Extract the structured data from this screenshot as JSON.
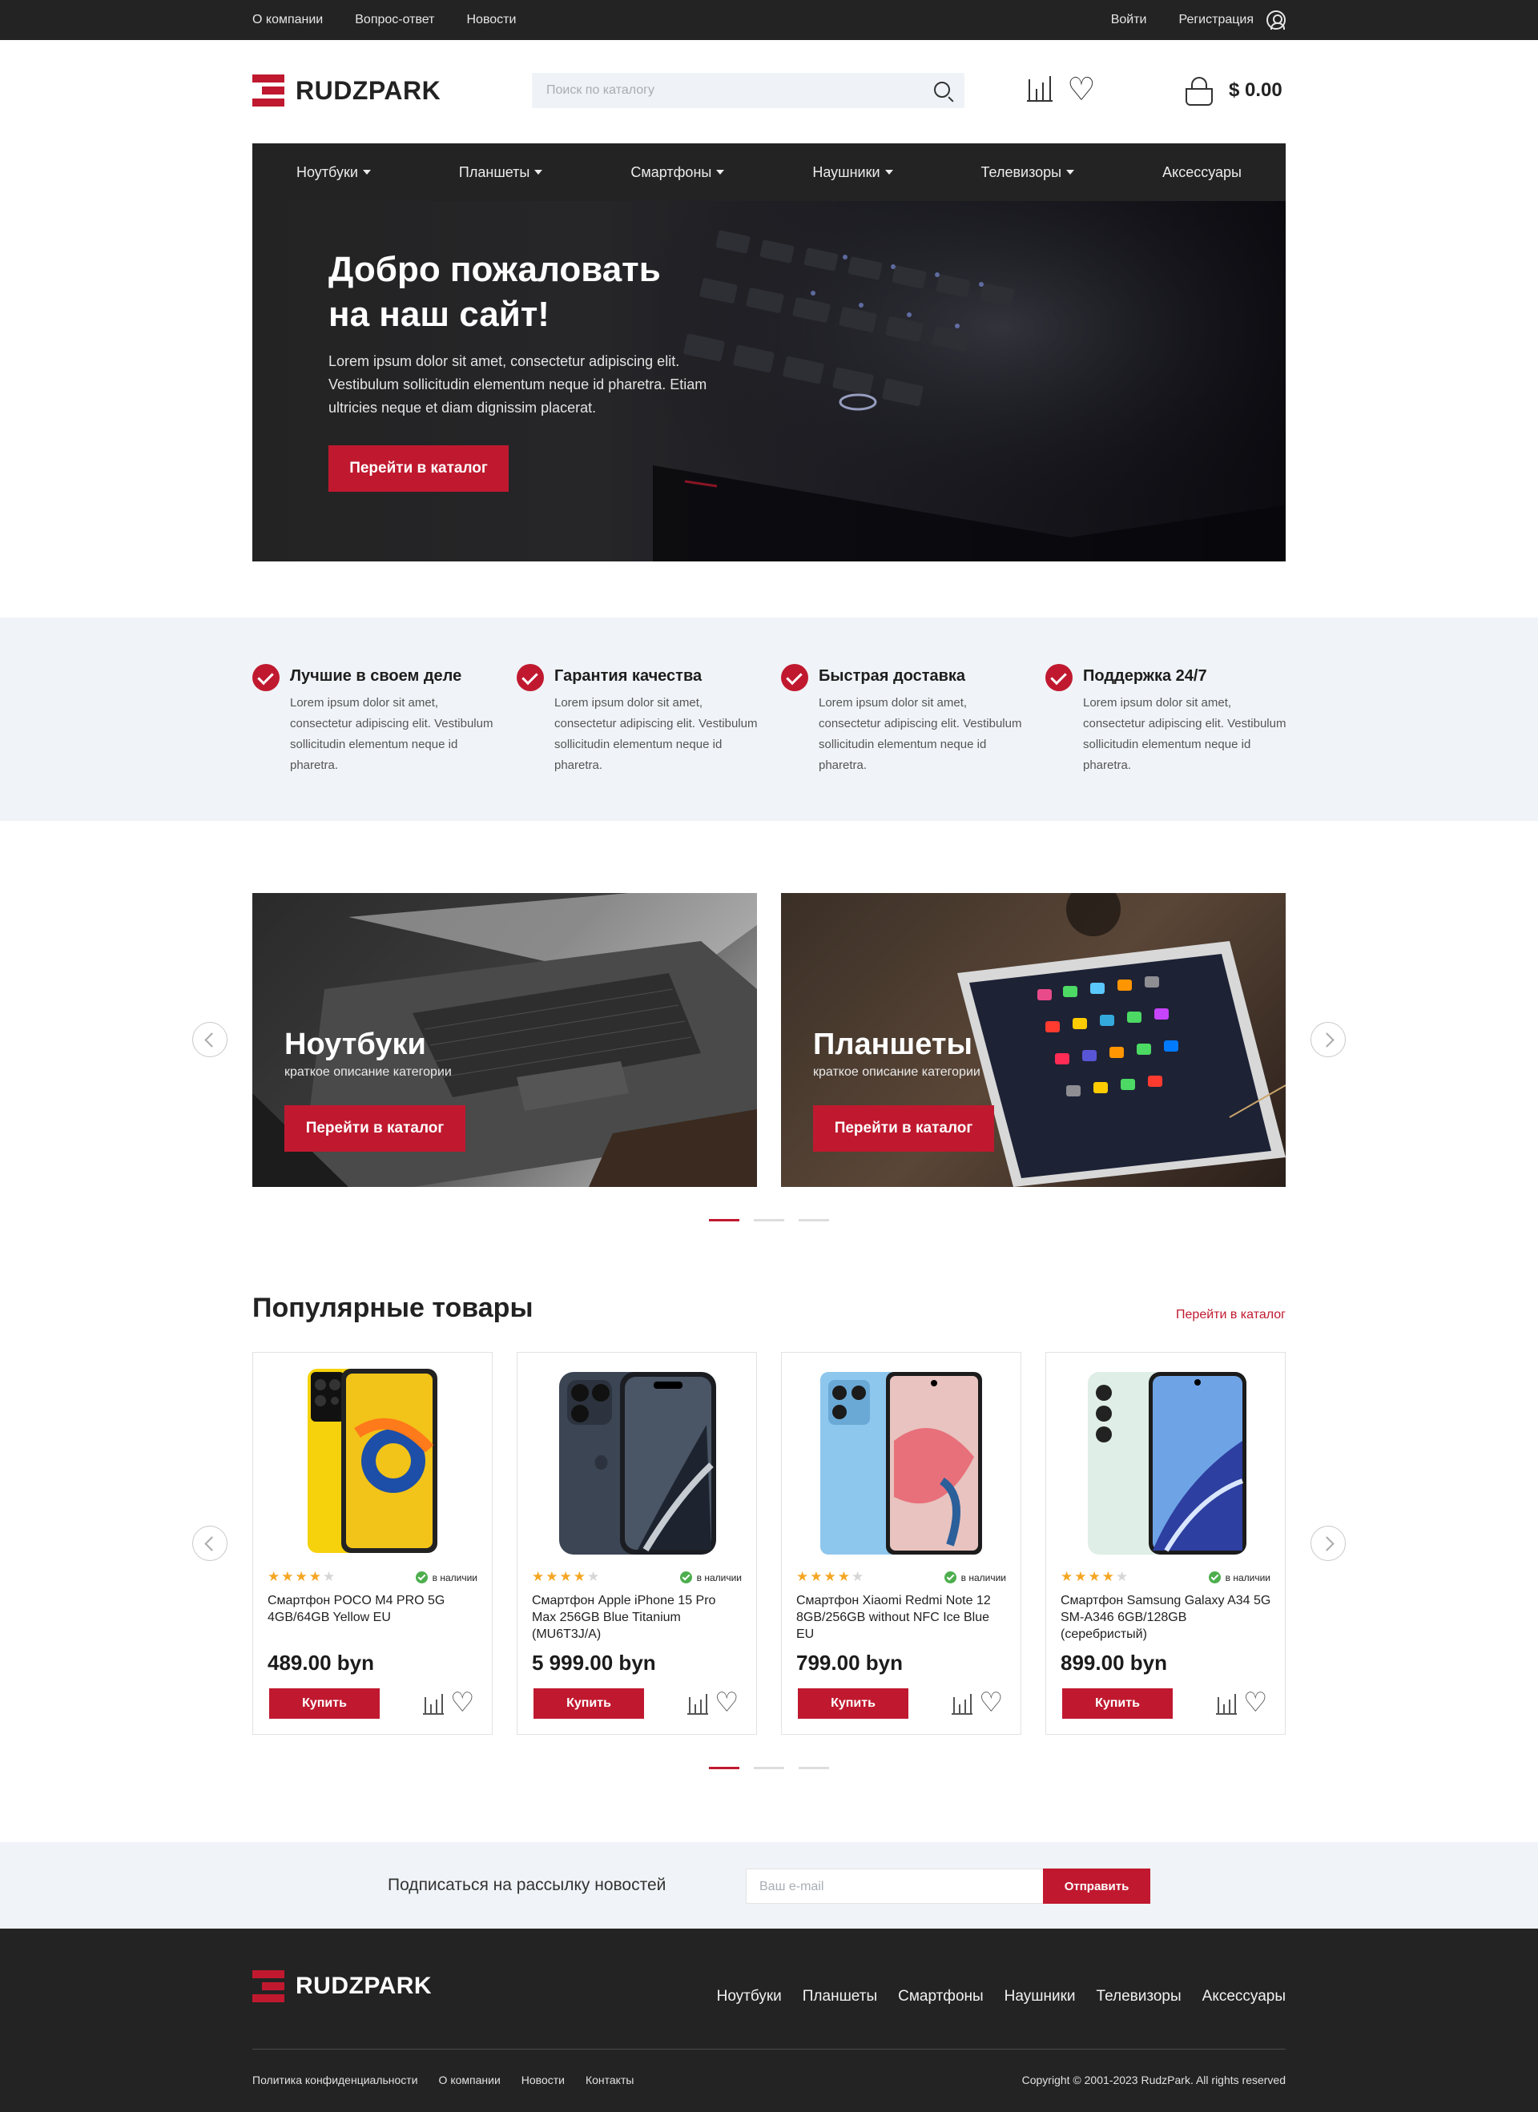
{
  "topbar": {
    "links": [
      "О компании",
      "Вопрос-ответ",
      "Новости"
    ],
    "login": "Войти",
    "register": "Регистрация"
  },
  "header": {
    "logo": "RUDZPARK",
    "search_placeholder": "Поиск по каталогу",
    "cart_total": "$ 0.00"
  },
  "nav": {
    "items": [
      {
        "label": "Ноутбуки",
        "dropdown": true
      },
      {
        "label": "Планшеты",
        "dropdown": true
      },
      {
        "label": "Смартфоны",
        "dropdown": true
      },
      {
        "label": "Наушники",
        "dropdown": true
      },
      {
        "label": "Телевизоры",
        "dropdown": true
      },
      {
        "label": "Аксессуары",
        "dropdown": false
      }
    ]
  },
  "hero": {
    "title_line1": "Добро пожаловать",
    "title_line2": "на наш сайт!",
    "text": "Lorem ipsum dolor sit amet, consectetur adipiscing elit. Vestibulum sollicitudin elementum neque id pharetra. Etiam ultricies neque et diam dignissim placerat.",
    "button": "Перейти в каталог"
  },
  "features": [
    {
      "title": "Лучшие в своем деле",
      "text": "Lorem ipsum dolor sit amet, consectetur adipiscing elit. Vestibulum sollicitudin elementum neque id pharetra."
    },
    {
      "title": "Гарантия качества",
      "text": "Lorem ipsum dolor sit amet, consectetur adipiscing elit. Vestibulum sollicitudin elementum neque id pharetra."
    },
    {
      "title": "Быстрая доставка",
      "text": "Lorem ipsum dolor sit amet, consectetur adipiscing elit. Vestibulum sollicitudin elementum neque id pharetra."
    },
    {
      "title": "Поддержка 24/7",
      "text": "Lorem ipsum dolor sit amet, consectetur adipiscing elit. Vestibulum sollicitudin elementum neque id pharetra."
    }
  ],
  "categories": {
    "slides": [
      {
        "title": "Ноутбуки",
        "desc": "краткое описание категории",
        "button": "Перейти в каталог"
      },
      {
        "title": "Планшеты",
        "desc": "краткое описание категории",
        "button": "Перейти в каталог"
      }
    ],
    "active_dot": 1,
    "dot_count": 3
  },
  "popular": {
    "title": "Популярные товары",
    "link": "Перейти в каталог",
    "active_dot": 1,
    "dot_count": 3,
    "products": [
      {
        "name": "Смартфон POCO M4 PRO 5G 4GB/64GB Yellow EU",
        "price": "489.00 byn",
        "rating": 4,
        "stock": "в наличии",
        "button": "Купить"
      },
      {
        "name": "Смартфон Apple iPhone 15 Pro Max 256GB Blue Titanium (MU6T3J/A)",
        "price": "5 999.00 byn",
        "rating": 4,
        "stock": "в наличии",
        "button": "Купить"
      },
      {
        "name": "Смартфон Xiaomi Redmi Note 12 8GB/256GB without NFC Ice Blue EU",
        "price": "799.00 byn",
        "rating": 4,
        "stock": "в наличии",
        "button": "Купить"
      },
      {
        "name": "Смартфон Samsung Galaxy A34 5G SM-A346 6GB/128GB (серебристый)",
        "price": "899.00 byn",
        "rating": 4,
        "stock": "в наличии",
        "button": "Купить"
      }
    ]
  },
  "newsletter": {
    "label": "Подписаться на рассылку новостей",
    "placeholder": "Ваш e-mail",
    "button": "Отправить"
  },
  "footer": {
    "logo": "RUDZPARK",
    "nav": [
      "Ноутбуки",
      "Планшеты",
      "Смартфоны",
      "Наушники",
      "Телевизоры",
      "Аксессуары"
    ],
    "bottom_links": [
      "Политика конфиденциальности",
      "О компании",
      "Новости",
      "Контакты"
    ],
    "copyright": "Copyright © 2001-2023 RudzPark. All rights reserved"
  },
  "colors": {
    "accent": "#c0192f",
    "dark": "#232323",
    "light_bg": "#f0f3f7",
    "rating_star": "#f5a623",
    "stock_ok": "#4cae4c"
  },
  "icons": [
    "user-icon",
    "search-icon",
    "compare-icon",
    "heart-icon",
    "cart-icon",
    "chevron-down-icon",
    "check-icon",
    "star-icon",
    "arrow-left-icon",
    "arrow-right-icon"
  ]
}
